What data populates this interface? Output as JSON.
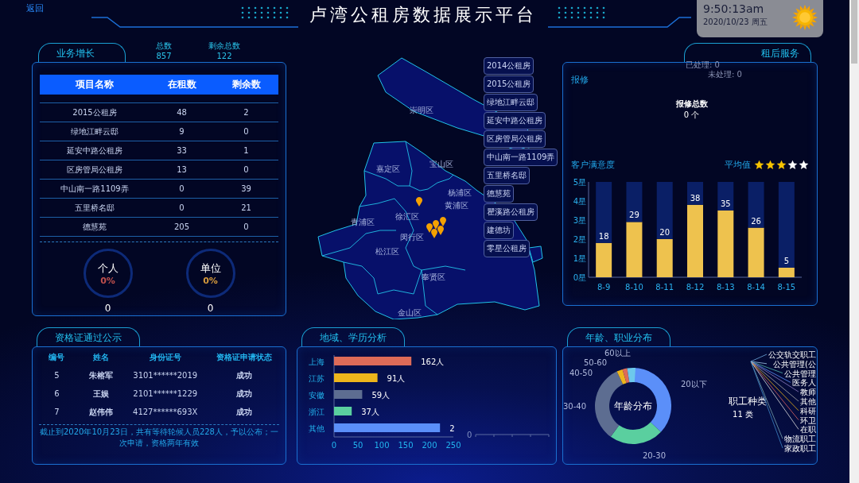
{
  "back_link": "返回",
  "title": "卢湾公租房数据展示平台",
  "clock": {
    "time": "9:50:13am",
    "date": "2020/10/23 周五"
  },
  "business": {
    "title": "业务增长",
    "totals": [
      {
        "label": "总数",
        "value": "857"
      },
      {
        "label": "剩余总数",
        "value": "122"
      }
    ],
    "columns": [
      "项目名称",
      "在租数",
      "剩余数"
    ],
    "rows": [
      [
        "2015公租房",
        "48",
        "2"
      ],
      [
        "绿地江畔云邸",
        "9",
        "0"
      ],
      [
        "延安中路公租房",
        "33",
        "1"
      ],
      [
        "区房管局公租房",
        "13",
        "0"
      ],
      [
        "中山南一路1109弄",
        "0",
        "39"
      ],
      [
        "五里桥名邸",
        "0",
        "21"
      ],
      [
        "德慧苑",
        "205",
        "0"
      ]
    ],
    "gauges": [
      {
        "label": "个人",
        "percent": "0%",
        "count": "0",
        "color": "#c0504d"
      },
      {
        "label": "单位",
        "percent": "0%",
        "count": "0",
        "color": "#d69a3c"
      }
    ]
  },
  "map": {
    "districts": [
      "崇明区",
      "宝山区",
      "嘉定区",
      "杨浦区",
      "黄浦区",
      "徐汇区",
      "青浦区",
      "闵行区",
      "松江区",
      "奉贤区",
      "金山区"
    ],
    "legend": [
      "2014公租房",
      "2015公租房",
      "绿地江畔云邸",
      "延安中路公租房",
      "区房管局公租房",
      "中山南一路1109弄",
      "五里桥名邸",
      "德慧苑",
      "瞿溪路公租房",
      "建德坊",
      "零星公租房"
    ]
  },
  "service": {
    "title": "租后服务",
    "processed": "已处理: 0",
    "unprocessed": "未处理: 0",
    "repair_title": "报修",
    "repair_total_label": "报修总数",
    "repair_total": "0 个",
    "satisfaction_title": "客户满意度",
    "average_label": "平均值",
    "stars": 3,
    "chart_data": {
      "type": "bar",
      "categories": [
        "8-9",
        "8-10",
        "8-11",
        "8-12",
        "8-13",
        "8-14",
        "8-15"
      ],
      "stacked": true,
      "series": [
        {
          "color": "#eec24e",
          "values": [
            1.8,
            2.9,
            2.0,
            3.8,
            3.5,
            2.6,
            0.5
          ]
        },
        {
          "color": "#0a1f66",
          "values": [
            3.2,
            2.1,
            3.0,
            1.2,
            1.5,
            2.4,
            4.5
          ]
        }
      ],
      "value_labels": [
        "18",
        "29",
        "20",
        "38",
        "35",
        "26",
        "5"
      ],
      "ylim": [
        0,
        5
      ],
      "yticks": [
        {
          "value": 0,
          "label": "0星"
        },
        {
          "value": 1,
          "label": "1星"
        },
        {
          "value": 2,
          "label": "2星"
        },
        {
          "value": 3,
          "label": "3星"
        },
        {
          "value": 4,
          "label": "4星"
        },
        {
          "value": 5,
          "label": "5星"
        }
      ]
    }
  },
  "certificates": {
    "title": "资格证通过公示",
    "columns": [
      "编号",
      "姓名",
      "身份证号",
      "资格证申请状态"
    ],
    "rows": [
      [
        "5",
        "朱榕军",
        "3101******2019",
        "成功"
      ],
      [
        "6",
        "王娱",
        "2101******1229",
        "成功"
      ],
      [
        "7",
        "赵伟伟",
        "4127******693X",
        "成功"
      ]
    ],
    "note": "截止到2020年10月23日，共有等待轮候人员228人，予以公布；一次申请，资格两年有效"
  },
  "region": {
    "title": "地域、学历分析",
    "chart_data": {
      "type": "bar",
      "orientation": "horizontal",
      "categories": [
        "上海",
        "江苏",
        "安徽",
        "浙江",
        "其他"
      ],
      "series": [
        {
          "values": [
            162,
            91,
            59,
            37,
            222
          ]
        }
      ],
      "colors": [
        "#dd6b58",
        "#edb51c",
        "#5d6d91",
        "#5acf9f",
        "#5b8ff9"
      ],
      "value_labels": [
        "162人",
        "91人",
        "59人",
        "37人",
        "2"
      ],
      "xlim": [
        0,
        250
      ],
      "xticks": [
        0,
        50,
        100,
        150,
        200,
        250
      ]
    },
    "education_axis_label": "0"
  },
  "age": {
    "title": "年龄、职业分布",
    "center_label": "年龄分布",
    "segments": [
      {
        "label": "20以下",
        "color": "#5b8ff9"
      },
      {
        "label": "20-30",
        "color": "#5acf9f"
      },
      {
        "label": "30-40",
        "color": "#5d6d91"
      },
      {
        "label": "40-50",
        "color": "#edb51c"
      },
      {
        "label": "50-60",
        "color": "#dd6b58"
      },
      {
        "label": "60以上",
        "color": "#6dc8ec"
      }
    ],
    "jobs_title": "职工种类",
    "jobs_count": "11 类",
    "jobs": [
      "公交轨交职工",
      "公共管理(公",
      "公共管理",
      "医务人",
      "教师",
      "其他",
      "科研",
      "环卫",
      "在职",
      "物流职工",
      "家政职工"
    ]
  }
}
